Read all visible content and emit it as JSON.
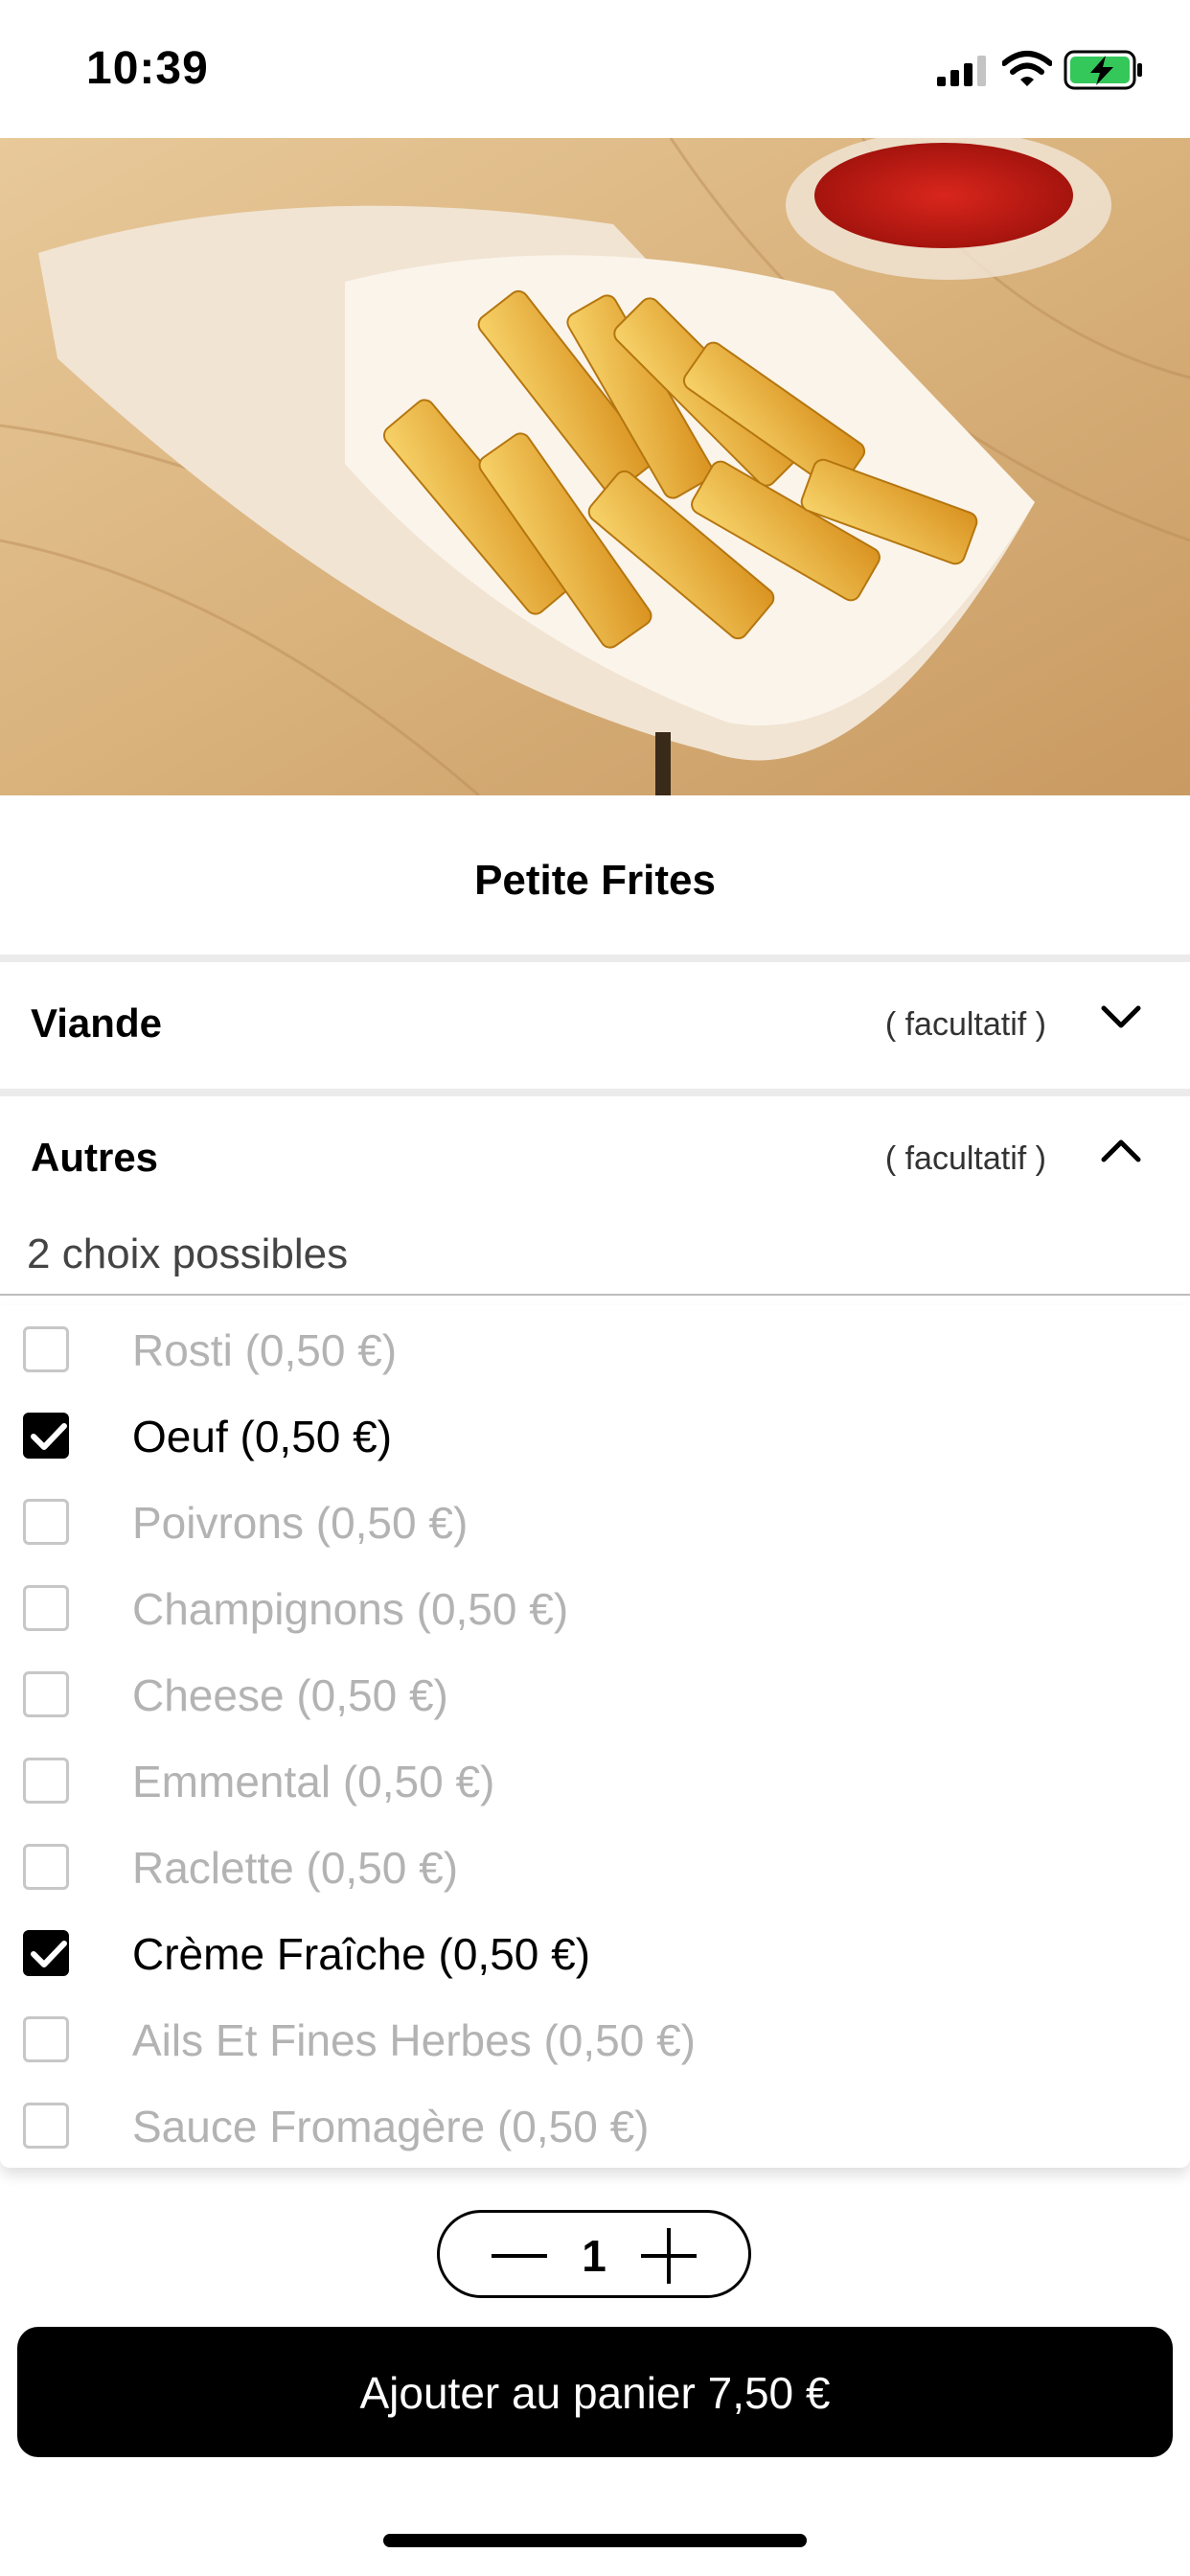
{
  "status_bar": {
    "time": "10:39",
    "icons": [
      "signal-icon",
      "wifi-icon",
      "battery-charging-icon"
    ]
  },
  "hero": {
    "image_alt": "fries-in-paper-cone-photo"
  },
  "product": {
    "title": "Petite Frites"
  },
  "sections": [
    {
      "title": "Viande",
      "optional_label": "( facultatif )",
      "expanded": false,
      "icon": "chevron-down-icon"
    },
    {
      "title": "Autres",
      "optional_label": "( facultatif )",
      "expanded": true,
      "icon": "chevron-up-icon",
      "hint": "2 choix possibles"
    }
  ],
  "options": [
    {
      "label": "Rosti (0,50 €)",
      "checked": false
    },
    {
      "label": "Oeuf (0,50 €)",
      "checked": true
    },
    {
      "label": "Poivrons (0,50 €)",
      "checked": false
    },
    {
      "label": "Champignons (0,50 €)",
      "checked": false
    },
    {
      "label": "Cheese (0,50 €)",
      "checked": false
    },
    {
      "label": "Emmental (0,50 €)",
      "checked": false
    },
    {
      "label": "Raclette (0,50 €)",
      "checked": false
    },
    {
      "label": "Crème Fraîche (0,50 €)",
      "checked": true
    },
    {
      "label": "Ails Et Fines Herbes (0,50 €)",
      "checked": false
    },
    {
      "label": "Sauce Fromagère (0,50 €)",
      "checked": false
    }
  ],
  "quantity": {
    "value": "1"
  },
  "cart_button": {
    "label": "Ajouter au panier 7,50 €"
  },
  "colors": {
    "accent": "#000000",
    "disabled_text": "#b3b3b3",
    "separator": "#ebebeb",
    "battery": "#34c759"
  }
}
